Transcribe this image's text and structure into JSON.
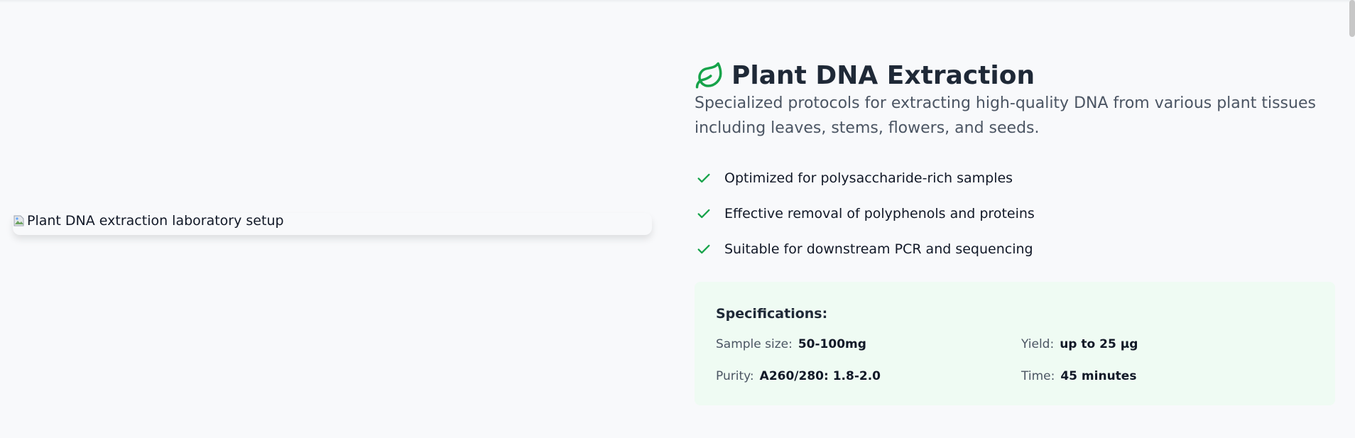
{
  "colors": {
    "accent_green": "#16a34a",
    "card_bg": "#effbf3",
    "page_bg": "#f8f9fb",
    "title": "#1f2937",
    "muted": "#4b5563"
  },
  "image": {
    "alt": "Plant DNA extraction laboratory setup",
    "icon": "broken-image-icon"
  },
  "section": {
    "icon": "leaf-icon",
    "title": "Plant DNA Extraction",
    "description": "Specialized protocols for extracting high-quality DNA from various plant tissues including leaves, stems, flowers, and seeds."
  },
  "features": [
    {
      "icon": "check-icon",
      "text": "Optimized for polysaccharide-rich samples"
    },
    {
      "icon": "check-icon",
      "text": "Effective removal of polyphenols and proteins"
    },
    {
      "icon": "check-icon",
      "text": "Suitable for downstream PCR and sequencing"
    }
  ],
  "specifications": {
    "heading": "Specifications:",
    "sample_size": {
      "label": "Sample size:",
      "value": "50-100mg"
    },
    "yield": {
      "label": "Yield:",
      "value": "up to 25 µg"
    },
    "purity": {
      "label": "Purity:",
      "value": "A260/280: 1.8-2.0"
    },
    "time": {
      "label": "Time:",
      "value": "45 minutes"
    }
  }
}
